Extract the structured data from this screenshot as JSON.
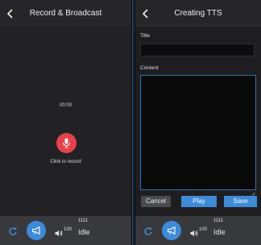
{
  "left_panel": {
    "title": "Record & Broadcast",
    "timer": "00:00",
    "record_label": "Click to record"
  },
  "right_panel": {
    "title": "Creating TTS",
    "title_field_label": "Title",
    "title_value": "",
    "content_field_label": "Content",
    "content_value": "",
    "buttons": {
      "cancel": "Cancel",
      "play": "Play",
      "save": "Save"
    }
  },
  "footer": {
    "volume": "100",
    "id": "1111",
    "status": "Idle"
  },
  "colors": {
    "accent": "#3d8bd8",
    "record": "#e8414b",
    "focus_border": "#2e6fb0",
    "footer_bg": "#38393c"
  },
  "icons": [
    "back-icon",
    "microphone-icon",
    "refresh-icon",
    "broadcast-icon",
    "volume-icon"
  ]
}
